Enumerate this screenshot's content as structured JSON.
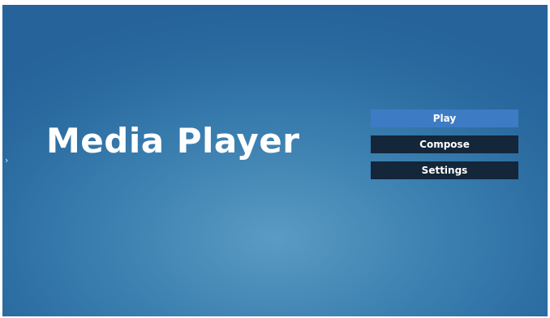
{
  "app": {
    "title": "Media Player"
  },
  "menu": {
    "items": [
      {
        "label": "Play",
        "selected": true
      },
      {
        "label": "Compose",
        "selected": false
      },
      {
        "label": "Settings",
        "selected": false
      }
    ]
  },
  "nav": {
    "left_icon": "chevron-right-icon",
    "right_icon": "chevron-left-icon",
    "left_glyph": "›",
    "right_glyph": "‹"
  },
  "colors": {
    "selected_button": "#3d7cc4",
    "button": "#13263a",
    "background": "#3b7fb0"
  }
}
